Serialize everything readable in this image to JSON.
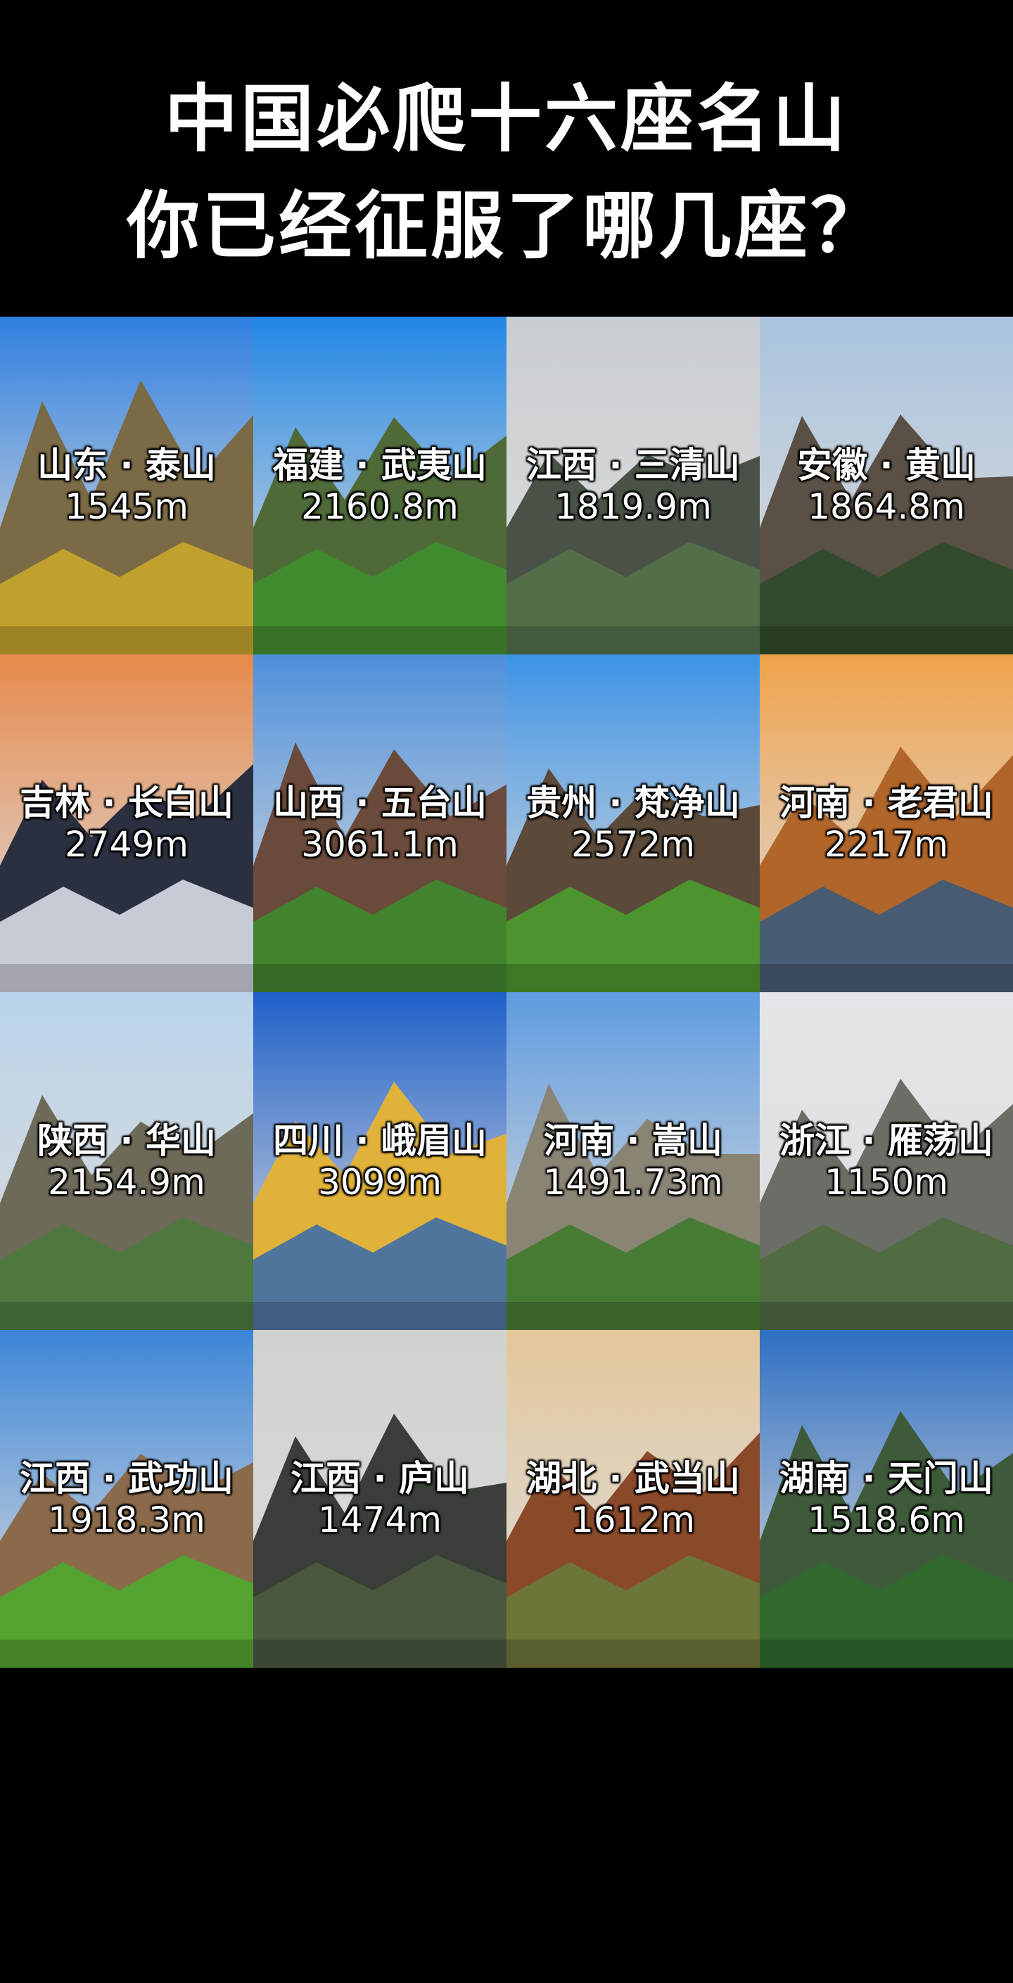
{
  "title": {
    "line1": "中国必爬十六座名山",
    "line2": "你已经征服了哪几座？"
  },
  "mountains": [
    {
      "name": "山东 · 泰山",
      "height": "1545m",
      "sky": "#2f7fe0",
      "rock": "#7a6a45",
      "green": "#c9a72a"
    },
    {
      "name": "福建 · 武夷山",
      "height": "2160.8m",
      "sky": "#1f86e6",
      "rock": "#4f6a38",
      "green": "#3f8f2f"
    },
    {
      "name": "江西 · 三清山",
      "height": "1819.9m",
      "sky": "#c9ced3",
      "rock": "#4a5248",
      "green": "#55714a"
    },
    {
      "name": "安徽 · 黄山",
      "height": "1864.8m",
      "sky": "#a9c3dd",
      "rock": "#5a5046",
      "green": "#2f4a2a"
    },
    {
      "name": "吉林 · 长白山",
      "height": "2749m",
      "sky": "#e7894a",
      "rock": "#2a3040",
      "green": "#d8dde6"
    },
    {
      "name": "山西 · 五台山",
      "height": "3061.1m",
      "sky": "#4d8fdc",
      "rock": "#6a4a3a",
      "green": "#3d8a2e"
    },
    {
      "name": "贵州 · 梵净山",
      "height": "2572m",
      "sky": "#3d93e6",
      "rock": "#5b4a3a",
      "green": "#4b9b2e"
    },
    {
      "name": "河南 · 老君山",
      "height": "2217m",
      "sky": "#f0a24a",
      "rock": "#b0652a",
      "green": "#3c5a7a"
    },
    {
      "name": "陕西 · 华山",
      "height": "2154.9m",
      "sky": "#b9d3ea",
      "rock": "#6e6a5a",
      "green": "#4a7a3a"
    },
    {
      "name": "四川 · 峨眉山",
      "height": "3099m",
      "sky": "#1d5fc9",
      "rock": "#e0b23a",
      "green": "#3f6ea9"
    },
    {
      "name": "河南 · 嵩山",
      "height": "1491.73m",
      "sky": "#5e9be0",
      "rock": "#8a8474",
      "green": "#3f7a2e"
    },
    {
      "name": "浙江 · 雁荡山",
      "height": "1150m",
      "sky": "#e3e7ea",
      "rock": "#6a6e66",
      "green": "#4f6a3e"
    },
    {
      "name": "江西 · 武功山",
      "height": "1918.3m",
      "sky": "#3b86d8",
      "rock": "#8a6a4a",
      "green": "#4ea82e"
    },
    {
      "name": "江西 · 庐山",
      "height": "1474m",
      "sky": "#cfd2cf",
      "rock": "#3a3e38",
      "green": "#4a5a3e"
    },
    {
      "name": "湖北 · 武当山",
      "height": "1612m",
      "sky": "#e3c79a",
      "rock": "#8a4a2a",
      "green": "#6a7a3a"
    },
    {
      "name": "湖南 · 天门山",
      "height": "1518.6m",
      "sky": "#2e6fc2",
      "rock": "#3e5a3a",
      "green": "#2f6a2e"
    }
  ]
}
